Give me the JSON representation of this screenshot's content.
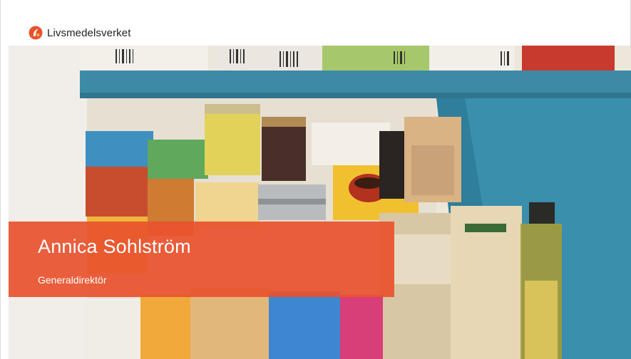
{
  "brand": {
    "name": "Livsmedelsverket",
    "logo_icon": "livsmedelsverket-logo-icon",
    "color": "#e8532e"
  },
  "hero": {
    "image_icon": "pantry-shelf-photo",
    "person_name": "Annica Sohlström",
    "person_title": "Generaldirektör",
    "band_color": "#e8532e"
  }
}
